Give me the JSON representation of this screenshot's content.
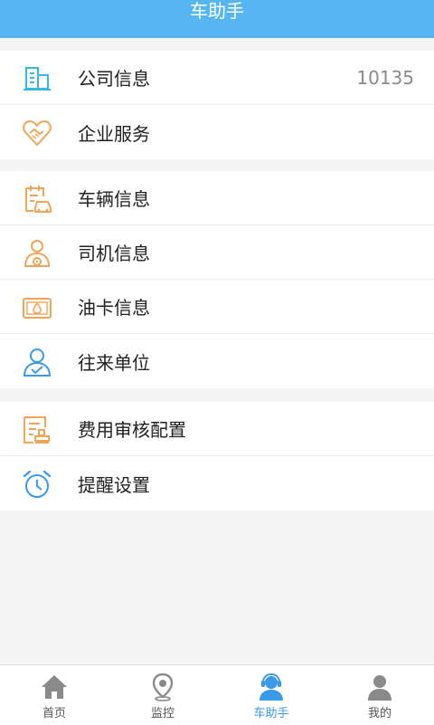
{
  "header": {
    "title": "车助手"
  },
  "groups": [
    {
      "items": [
        {
          "label": "公司信息",
          "value": "10135",
          "icon": "building-icon"
        },
        {
          "label": "企业服务",
          "icon": "handshake-heart-icon"
        }
      ]
    },
    {
      "items": [
        {
          "label": "车辆信息",
          "icon": "vehicle-doc-icon"
        },
        {
          "label": "司机信息",
          "icon": "driver-icon"
        },
        {
          "label": "油卡信息",
          "icon": "fuel-card-icon"
        },
        {
          "label": "往来单位",
          "icon": "partner-user-icon"
        }
      ]
    },
    {
      "items": [
        {
          "label": "费用审核配置",
          "icon": "expense-stamp-icon"
        },
        {
          "label": "提醒设置",
          "icon": "alarm-clock-icon"
        }
      ]
    }
  ],
  "tabbar": {
    "tabs": [
      {
        "label": "首页",
        "icon": "home-icon"
      },
      {
        "label": "监控",
        "icon": "location-pin-icon"
      },
      {
        "label": "车助手",
        "icon": "assistant-headset-icon",
        "active": true
      },
      {
        "label": "我的",
        "icon": "user-profile-icon"
      }
    ]
  },
  "colors": {
    "header": "#56b6f2",
    "accent_blue": "#3a9ae8",
    "icon_orange": "#f0a45a",
    "icon_cyan": "#35b8e6",
    "tab_gray": "#8a8a8a"
  }
}
